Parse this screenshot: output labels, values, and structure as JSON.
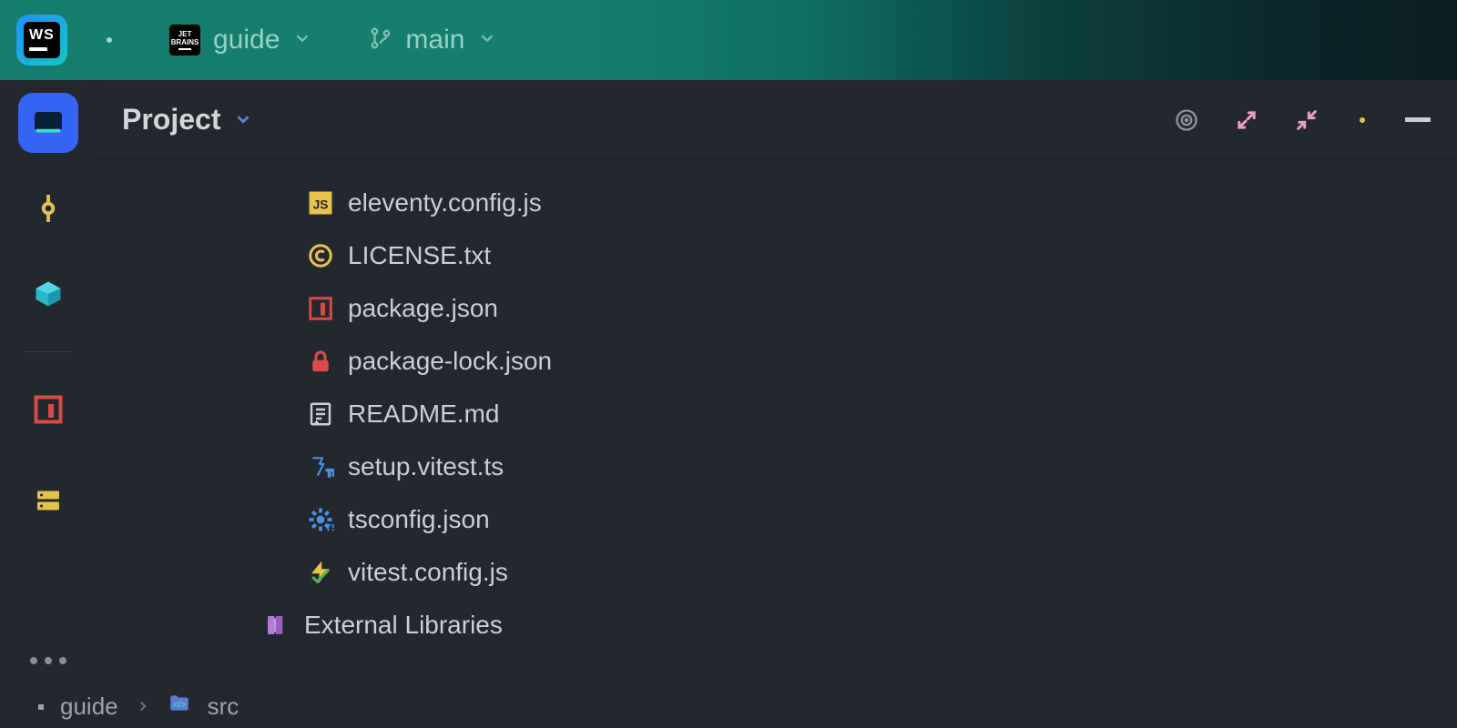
{
  "titlebar": {
    "app_badge": "WS",
    "project_name": "guide",
    "branch_name": "main"
  },
  "panel": {
    "title": "Project"
  },
  "tree": {
    "files": [
      {
        "name": "eleventy.config.js",
        "icon": "js"
      },
      {
        "name": "LICENSE.txt",
        "icon": "copyright"
      },
      {
        "name": "package.json",
        "icon": "npm"
      },
      {
        "name": "package-lock.json",
        "icon": "lock"
      },
      {
        "name": "README.md",
        "icon": "readme"
      },
      {
        "name": "setup.vitest.ts",
        "icon": "flask-ts"
      },
      {
        "name": "tsconfig.json",
        "icon": "ts-gear"
      },
      {
        "name": "vitest.config.js",
        "icon": "bolt"
      }
    ],
    "external_libraries_label": "External Libraries"
  },
  "breadcrumb": {
    "root": "guide",
    "current": "src"
  }
}
